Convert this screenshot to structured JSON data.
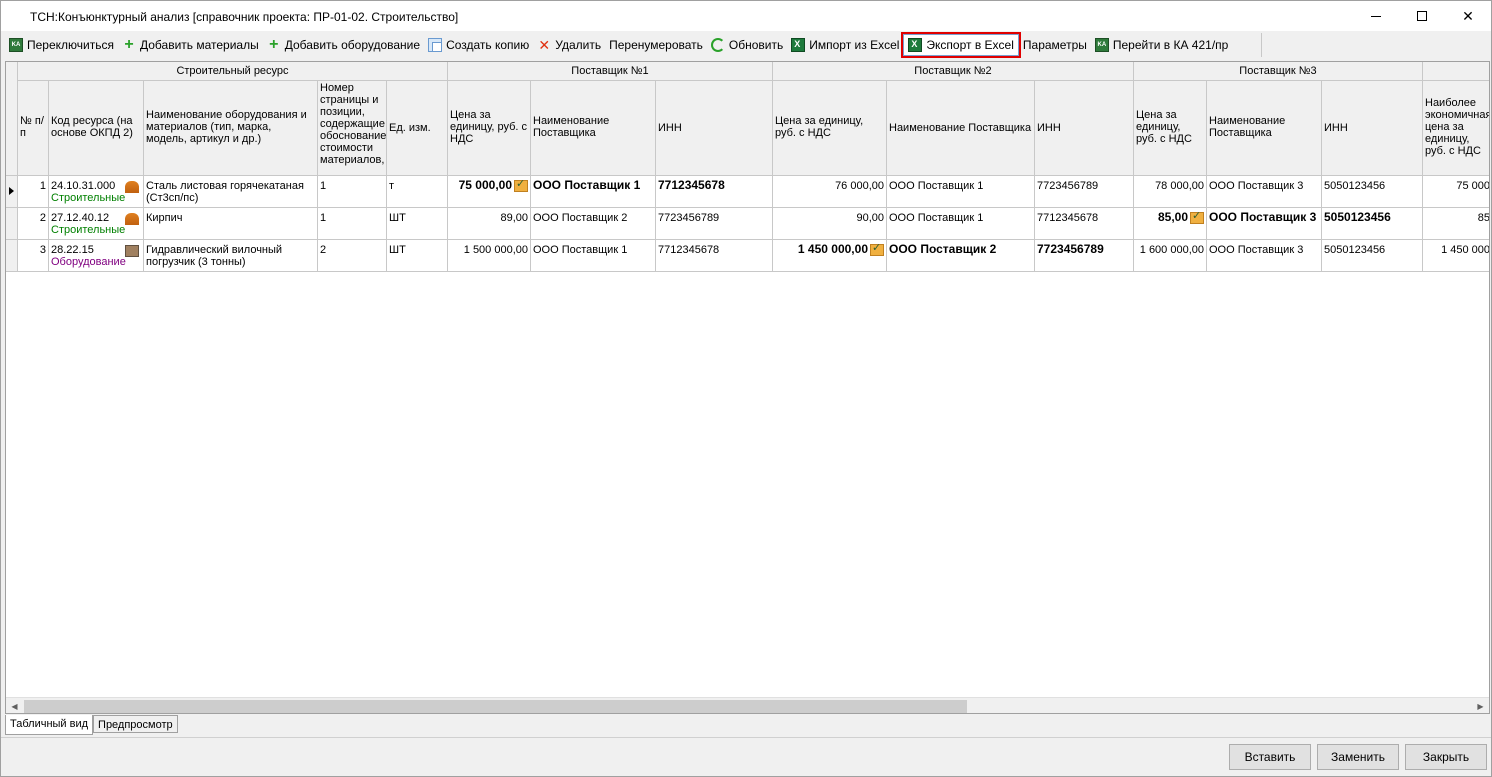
{
  "window": {
    "title": "ТСН:Конъюнктурный анализ [справочник проекта: ПР-01-02. Строительство]"
  },
  "toolbar": {
    "switch": "Переключиться",
    "add_materials": "Добавить материалы",
    "add_equipment": "Добавить оборудование",
    "create_copy": "Создать копию",
    "delete": "Удалить",
    "renumber": "Перенумеровать",
    "refresh": "Обновить",
    "import_excel": "Импорт из Excel",
    "export_excel": "Экспорт в Excel",
    "parameters": "Параметры",
    "goto_ka": "Перейти в КА 421/пр"
  },
  "grid": {
    "group_headers": {
      "resource": "Строительный ресурс",
      "supplier1": "Поставщик №1",
      "supplier2": "Поставщик №2",
      "supplier3": "Поставщик №3"
    },
    "columns": {
      "num": "№ п/п",
      "code": "Код ресурса (на основе ОКПД 2)",
      "name": "Наименование оборудования и материалов (тип, марка, модель, артикул и др.)",
      "page": "Номер страницы и позиции, содержащие обоснование стоимости материалов,",
      "unit": "Ед. изм.",
      "s1_price": "Цена за единицу, руб. с НДС",
      "s1_name": "Наименование Поставщика",
      "s1_inn": "ИНН",
      "s2_price": "Цена за единицу, руб. с НДС",
      "s2_name": "Наименование Поставщика",
      "s2_inn": "ИНН",
      "s3_price": "Цена за единицу, руб. с НДС",
      "s3_name": "Наименование Поставщика",
      "s3_inn": "ИНН",
      "best_price": "Наиболее экономичная цена за единицу, руб. с НДС"
    },
    "rows": [
      {
        "num": "1",
        "code": "24.10.31.000",
        "category": "Строительные",
        "name": "Сталь листовая горячекатаная (Ст3сп/пс)",
        "page": "1",
        "unit": "т",
        "s1_price": "75 000,00",
        "s1_name": "ООО Поставщик 1",
        "s1_inn": "7712345678",
        "s2_price": "76 000,00",
        "s2_name": "ООО Поставщик 1",
        "s2_inn": "7723456789",
        "s3_price": "78 000,00",
        "s3_name": "ООО Поставщик 3",
        "s3_inn": "5050123456",
        "best_price": "75 000"
      },
      {
        "num": "2",
        "code": "27.12.40.12",
        "category": "Строительные",
        "name": "Кирпич",
        "page": "1",
        "unit": "ШТ",
        "s1_price": "89,00",
        "s1_name": "ООО Поставщик 2",
        "s1_inn": "7723456789",
        "s2_price": "90,00",
        "s2_name": "ООО Поставщик 1",
        "s2_inn": "7712345678",
        "s3_price": "85,00",
        "s3_name": "ООО Поставщик 3",
        "s3_inn": "5050123456",
        "best_price": "85"
      },
      {
        "num": "3",
        "code": "28.22.15",
        "category": "Оборудование",
        "name": "Гидравлический вилочный погрузчик (3 тонны)",
        "page": "2",
        "unit": "ШТ",
        "s1_price": "1 500 000,00",
        "s1_name": "ООО Поставщик 1",
        "s1_inn": "7712345678",
        "s2_price": "1 450 000,00",
        "s2_name": "ООО Поставщик 2",
        "s2_inn": "7723456789",
        "s3_price": "1 600 000,00",
        "s3_name": "ООО Поставщик 3",
        "s3_inn": "5050123456",
        "best_price": "1 450 000"
      }
    ]
  },
  "tabs": {
    "table": "Табличный вид",
    "preview": "Предпросмотр"
  },
  "buttons": {
    "insert": "Вставить",
    "replace": "Заменить",
    "close": "Закрыть"
  }
}
